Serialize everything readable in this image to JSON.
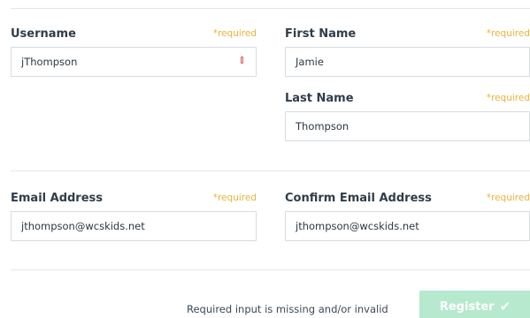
{
  "form": {
    "required_tag": "*required",
    "username": {
      "label": "Username",
      "value": "jThompson"
    },
    "first_name": {
      "label": "First Name",
      "value": "Jamie"
    },
    "last_name": {
      "label": "Last Name",
      "value": "Thompson"
    },
    "email": {
      "label": "Email Address",
      "value": "jthompson@wcskids.net"
    },
    "confirm_email": {
      "label": "Confirm Email Address",
      "value": "jthompson@wcskids.net"
    },
    "status_message": "Required input is missing and/or invalid",
    "register_label": "Register",
    "register_icon": "check-icon"
  },
  "colors": {
    "required": "#e8b23e",
    "button_disabled": "#b6e9ce",
    "error_marker": "#d9534f"
  }
}
